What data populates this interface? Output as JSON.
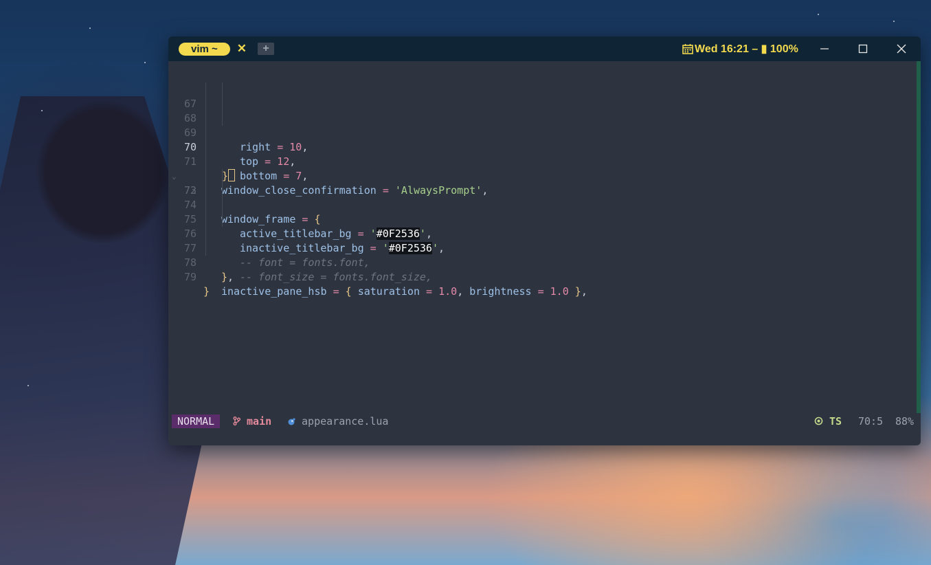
{
  "window": {
    "tab_label": "vim ~",
    "tab_close": "✕",
    "new_tab": "+",
    "status_right": "Wed 16:21 – ▮ 100%",
    "accent": "#f2d94e",
    "titlebar_bg": "#0f2536"
  },
  "editor": {
    "lines": [
      {
        "n": "67"
      },
      {
        "n": "68"
      },
      {
        "n": "69"
      },
      {
        "n": "70"
      },
      {
        "n": "71"
      },
      {
        "n": "72"
      },
      {
        "n": "73"
      },
      {
        "n": "74"
      },
      {
        "n": "75"
      },
      {
        "n": "76"
      },
      {
        "n": "77"
      },
      {
        "n": "78"
      },
      {
        "n": "79"
      }
    ],
    "tokens": {
      "right": "right",
      "top": "top",
      "bottom": "bottom",
      "ten": "10",
      "twelve": "12",
      "seven": "7",
      "wcc": "window_close_confirmation",
      "always": "'AlwaysPrompt'",
      "wf": "window_frame",
      "atb": "active_titlebar_bg",
      "itb": "inactive_titlebar_bg",
      "hex": "#0F2536",
      "c1": "-- font = fonts.font,",
      "c2": "-- font_size = fonts.font_size,",
      "iph": "inactive_pane_hsb",
      "sat": "saturation",
      "bri": "brightness",
      "one": "1.0"
    }
  },
  "statusline": {
    "mode": "NORMAL",
    "branch": "main",
    "file": "appearance.lua",
    "ts": "TS",
    "position": "70:5",
    "percent": "88%"
  }
}
